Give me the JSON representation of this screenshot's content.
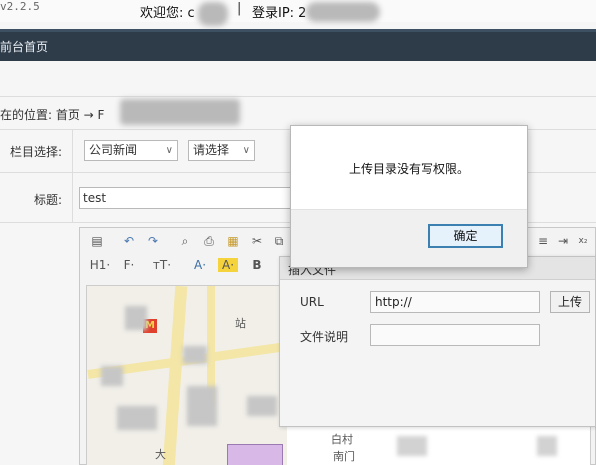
{
  "header": {
    "version": "v2.2.5",
    "welcome_label": "欢迎您: c",
    "separator": "|",
    "login_ip_label": "登录IP: 2"
  },
  "nav": {
    "home_label": "前台首页"
  },
  "breadcrumb": {
    "text": "在的位置: 首页 → F"
  },
  "form": {
    "category_label": "栏目选择:",
    "category_value": "公司新闻",
    "subcategory_value": "请选择",
    "title_label": "标题:",
    "title_value": "test"
  },
  "editor": {
    "toolbar_icons": [
      "paste-icon",
      "undo-icon",
      "redo-icon",
      "preview-icon",
      "print-icon",
      "template-icon",
      "cut-icon",
      "copy-icon"
    ],
    "toolbar2": [
      "H1·",
      "F·",
      "тT·",
      "A·",
      "A·",
      "B"
    ],
    "map_labels": [
      "站",
      "大",
      "白村",
      "南门"
    ]
  },
  "insert_panel": {
    "title": "插入文件",
    "url_label": "URL",
    "url_value": "http://",
    "upload_label": "上传",
    "desc_label": "文件说明",
    "desc_value": ""
  },
  "dialog": {
    "message": "上传目录没有写权限。",
    "ok_label": "确定"
  }
}
